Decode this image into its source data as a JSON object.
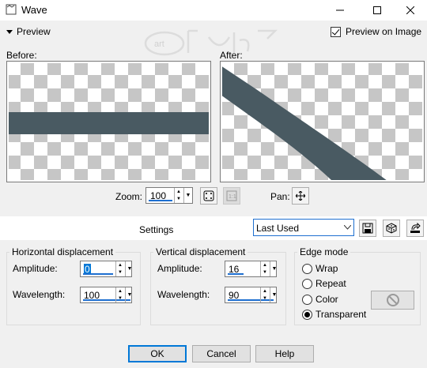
{
  "window": {
    "title": "Wave",
    "controls": [
      "minimize-icon",
      "maximize-icon",
      "close-icon"
    ]
  },
  "preview": {
    "toggle_label": "Preview",
    "preview_on_image_label": "Preview on Image",
    "preview_on_image_checked": true,
    "before_label": "Before:",
    "after_label": "After:",
    "band_color": "#495a62",
    "watermark": "Cartnaisem"
  },
  "zoom": {
    "label": "Zoom:",
    "value": "100",
    "fit_icon": "zoom-fit-icon",
    "actual_size_icon": "actual-size-icon",
    "pan_label": "Pan:",
    "pan_icon": "move-icon"
  },
  "settings": {
    "label": "Settings",
    "preset_value": "Last Used",
    "buttons": [
      "save-preset-icon",
      "randomize-icon",
      "reset-icon"
    ]
  },
  "horizontal": {
    "legend": "Horizontal displacement",
    "amplitude_label": "Amplitude:",
    "amplitude_value": "0",
    "wavelength_label": "Wavelength:",
    "wavelength_value": "100"
  },
  "vertical": {
    "legend": "Vertical displacement",
    "amplitude_label": "Amplitude:",
    "amplitude_value": "16",
    "wavelength_label": "Wavelength:",
    "wavelength_value": "90"
  },
  "edge_mode": {
    "legend": "Edge mode",
    "options": [
      "Wrap",
      "Repeat",
      "Color",
      "Transparent"
    ],
    "selected": "Transparent"
  },
  "buttons": {
    "ok": "OK",
    "cancel": "Cancel",
    "help": "Help"
  },
  "accent_color": "#0078d7"
}
